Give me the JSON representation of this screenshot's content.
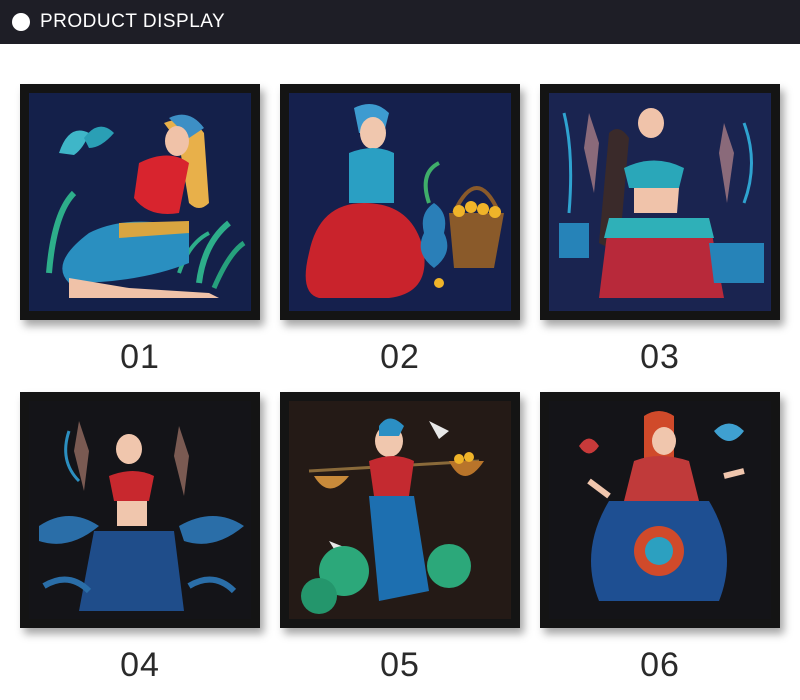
{
  "header": {
    "title": "PRODUCT DISPLAY"
  },
  "products": [
    {
      "number": "01",
      "bg": "#14204a"
    },
    {
      "number": "02",
      "bg": "#15204d"
    },
    {
      "number": "03",
      "bg": "#1a2450"
    },
    {
      "number": "04",
      "bg": "#141418"
    },
    {
      "number": "05",
      "bg": "#241a16"
    },
    {
      "number": "06",
      "bg": "#141418"
    }
  ],
  "colors": {
    "header_bg": "#1e1e26",
    "frame": "#141414",
    "number_text": "#2a2a2a"
  }
}
